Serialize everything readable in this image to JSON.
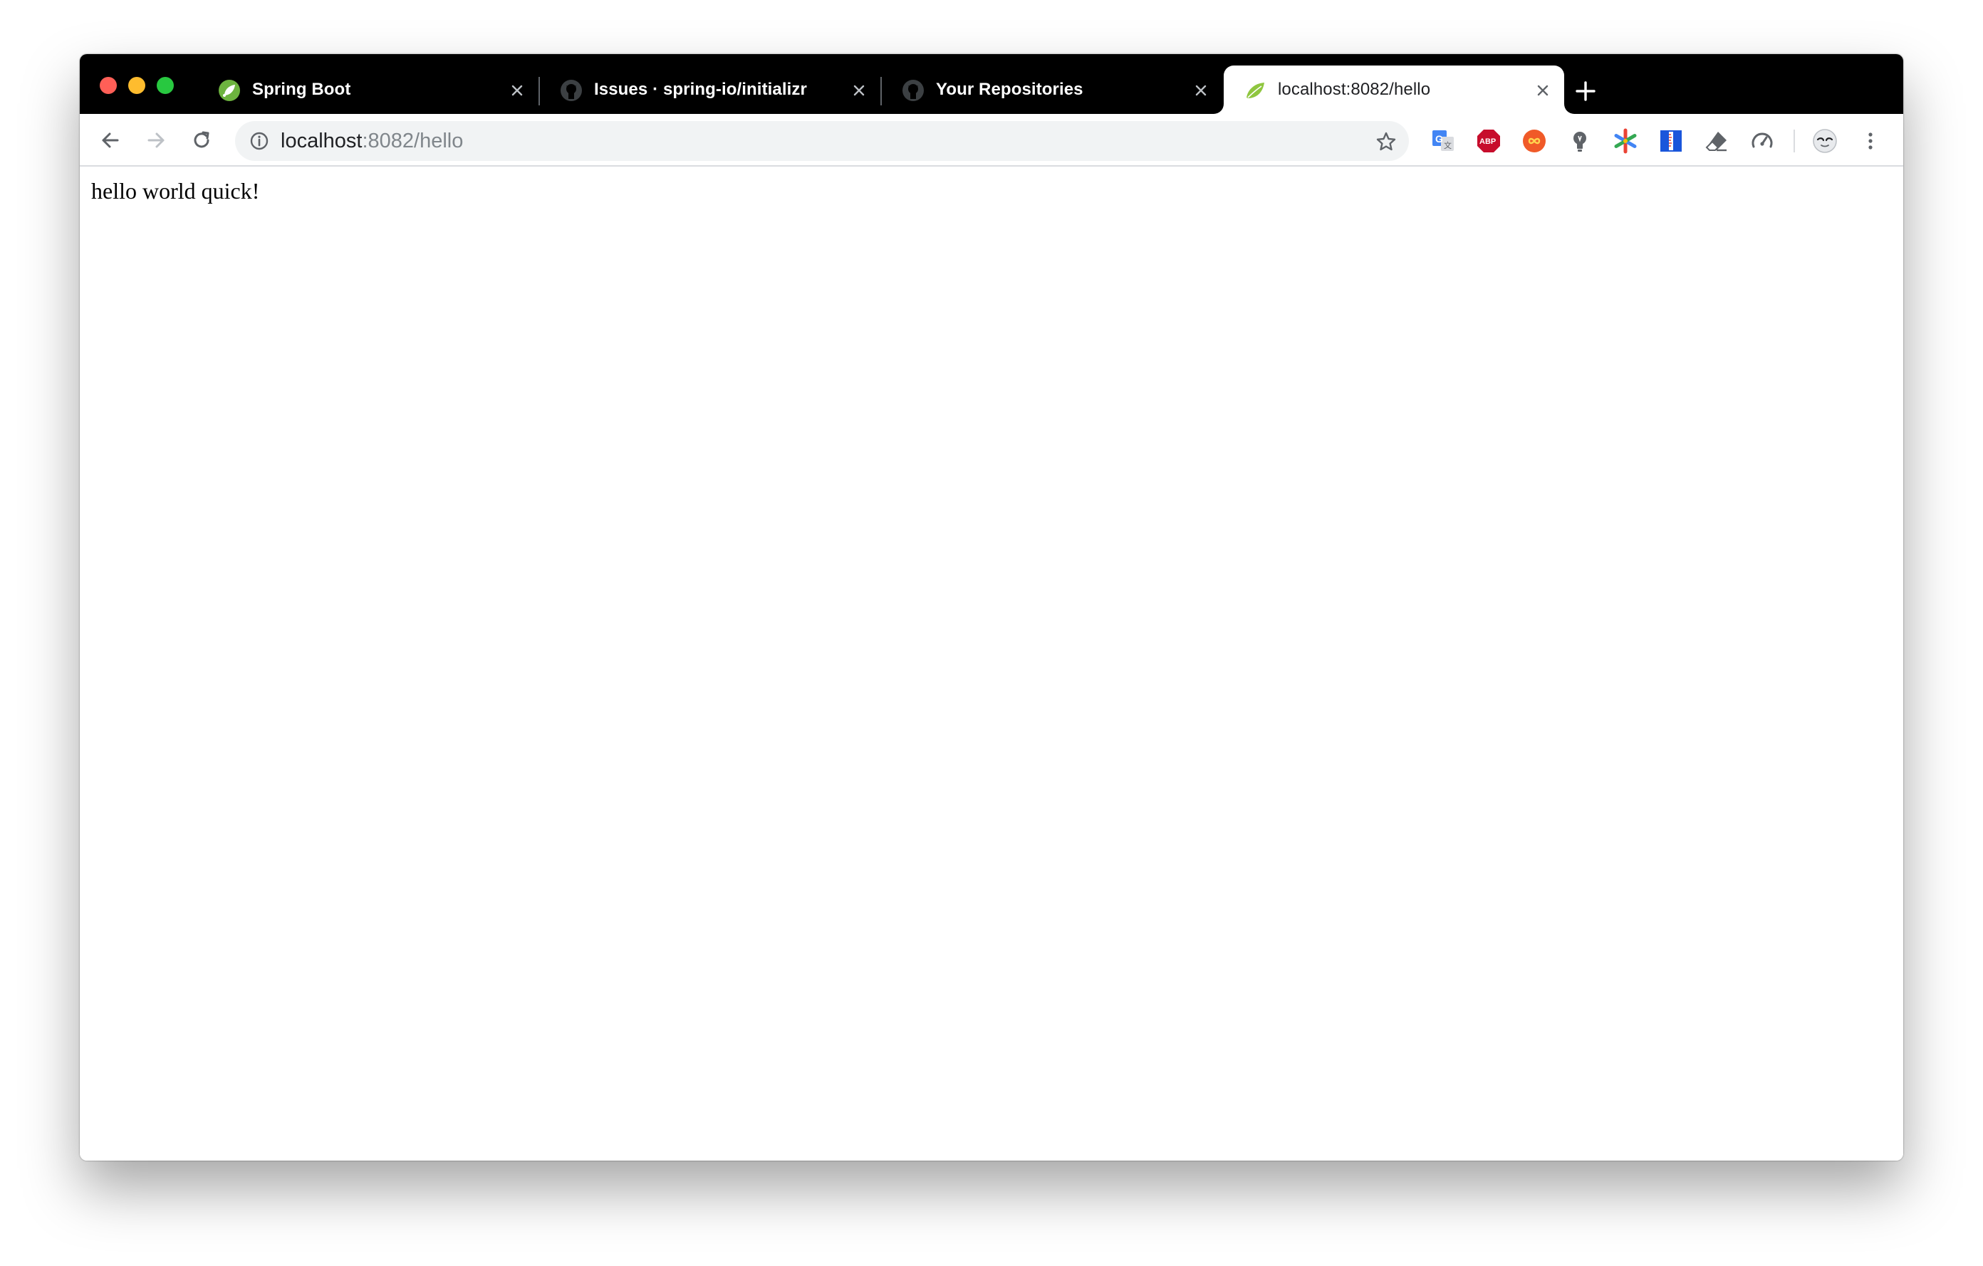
{
  "window": {
    "tabs": [
      {
        "title": "Spring Boot",
        "icon": "spring-icon",
        "active": false
      },
      {
        "title": "Issues · spring-io/initializr",
        "icon": "github-icon",
        "active": false
      },
      {
        "title": "Your Repositories",
        "icon": "github-icon",
        "active": false
      },
      {
        "title": "localhost:8082/hello",
        "icon": "spring-leaf-icon",
        "active": true
      }
    ]
  },
  "toolbar": {
    "url_host": "localhost",
    "url_path": ":8082/hello",
    "extensions": [
      "google-translate-icon",
      "adblock-plus-icon",
      "infinity-icon",
      "lightbulb-icon",
      "asterisk-icon",
      "ruler-icon",
      "eraser-icon",
      "speedometer-icon"
    ]
  },
  "page": {
    "text": "hello world quick!"
  },
  "colors": {
    "tabstrip": "#000000",
    "traffic_red": "#ff5f57",
    "traffic_yellow": "#febc2e",
    "traffic_green": "#28c840",
    "omnibox": "#f1f3f4",
    "spring_green": "#6db33f"
  }
}
